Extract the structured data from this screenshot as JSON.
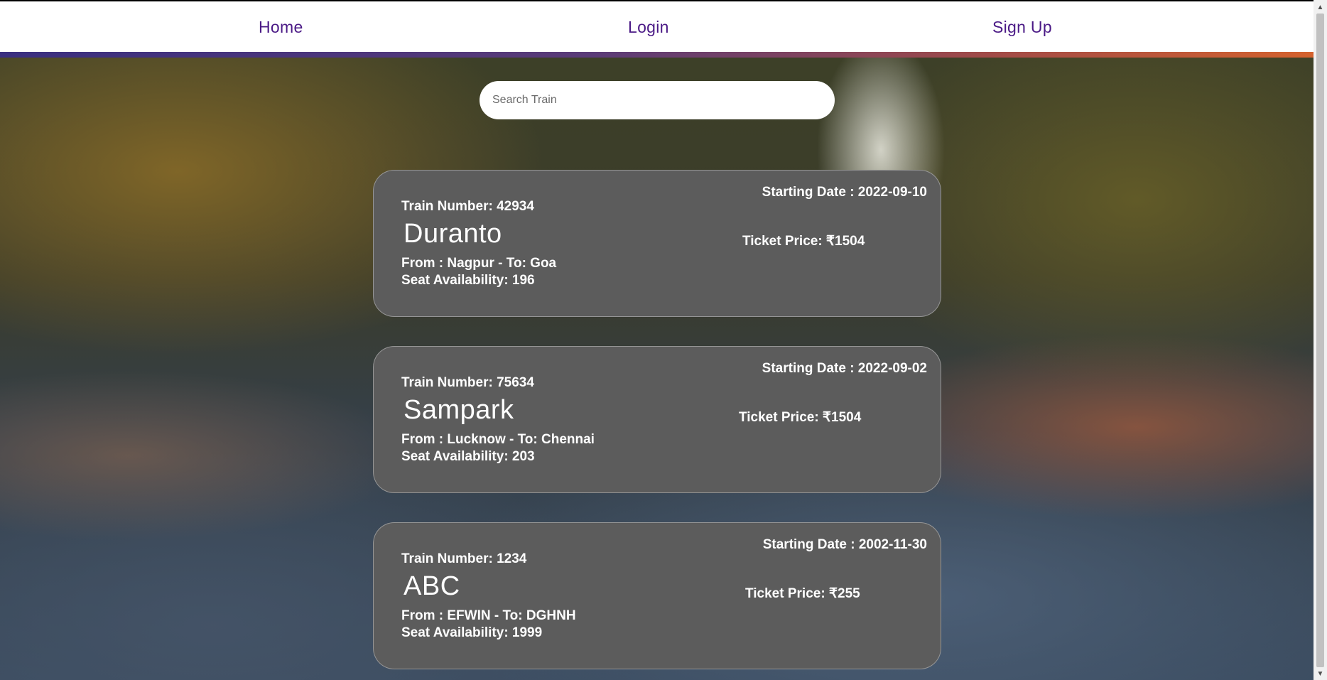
{
  "nav": {
    "home": "Home",
    "login": "Login",
    "signup": "Sign Up",
    "link_color": "#4b1a86"
  },
  "search": {
    "placeholder": "Search Train",
    "value": ""
  },
  "trains": [
    {
      "number_text": "Train Number: 42934",
      "name": "Duranto",
      "route_text": "From : Nagpur - To: Goa",
      "seats_text": "Seat Availability: 196",
      "date_text": "Starting Date : 2022-09-10",
      "price_text": "Ticket Price: ₹1504"
    },
    {
      "number_text": "Train Number: 75634",
      "name": "Sampark",
      "route_text": "From : Lucknow - To: Chennai",
      "seats_text": "Seat Availability: 203",
      "date_text": "Starting Date : 2022-09-02",
      "price_text": "Ticket Price: ₹1504"
    },
    {
      "number_text": "Train Number: 1234",
      "name": "ABC",
      "route_text": "From : EFWIN - To: DGHNH",
      "seats_text": "Seat Availability: 1999",
      "date_text": "Starting Date : 2002-11-30",
      "price_text": "Ticket Price: ₹255"
    }
  ],
  "colors": {
    "card_background": "#5c5c5c",
    "accent_gradient_start": "#3a2f80",
    "accent_gradient_end": "#d4622e"
  },
  "icons": {
    "scroll_up": "chevron-up-icon",
    "scroll_down": "chevron-down-icon"
  }
}
